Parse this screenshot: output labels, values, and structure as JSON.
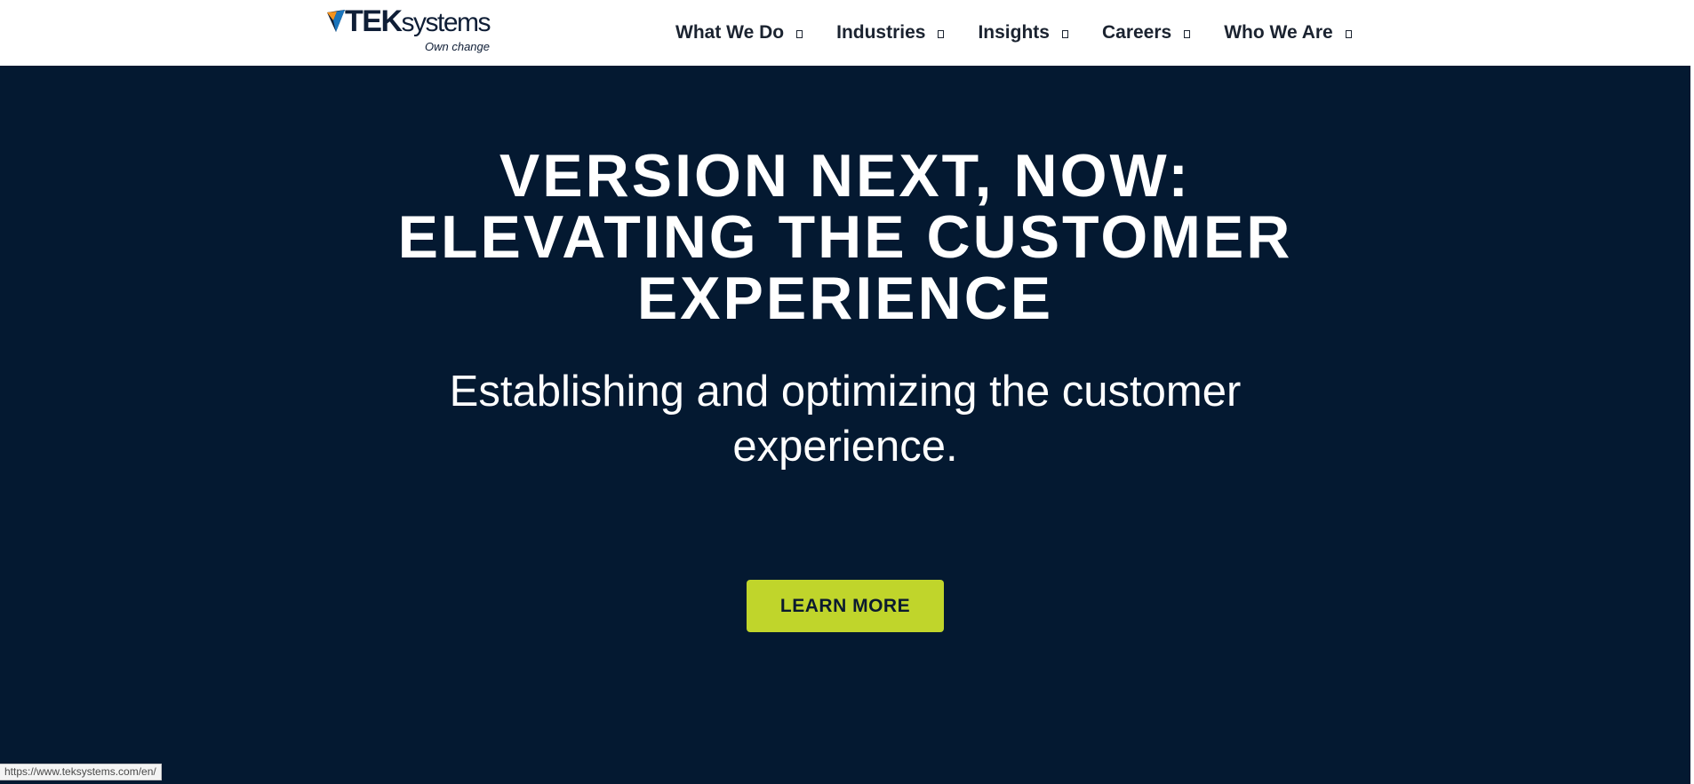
{
  "header": {
    "logo": {
      "wordmark_bold": "TEK",
      "wordmark_light": "systems",
      "tagline": "Own change",
      "mark_colors": [
        "#f7941d",
        "#1b75bc",
        "#0f1e36"
      ]
    },
    "nav": {
      "items": [
        {
          "label": "What We Do",
          "icon": "chevron-down-icon"
        },
        {
          "label": "Industries",
          "icon": "chevron-down-icon"
        },
        {
          "label": "Insights",
          "icon": "chevron-down-icon"
        },
        {
          "label": "Careers",
          "icon": "chevron-down-icon"
        },
        {
          "label": "Who We Are",
          "icon": "chevron-down-icon"
        }
      ]
    }
  },
  "hero": {
    "title": "Version Next, Now: Elevating the Customer Experience",
    "subtitle": "Establishing and optimizing the customer experience.",
    "cta_label": "LEARN MORE",
    "background_color": "#041931",
    "accent_color": "#c0d52b"
  },
  "status_bar": {
    "url": "https://www.teksystems.com/en/"
  }
}
